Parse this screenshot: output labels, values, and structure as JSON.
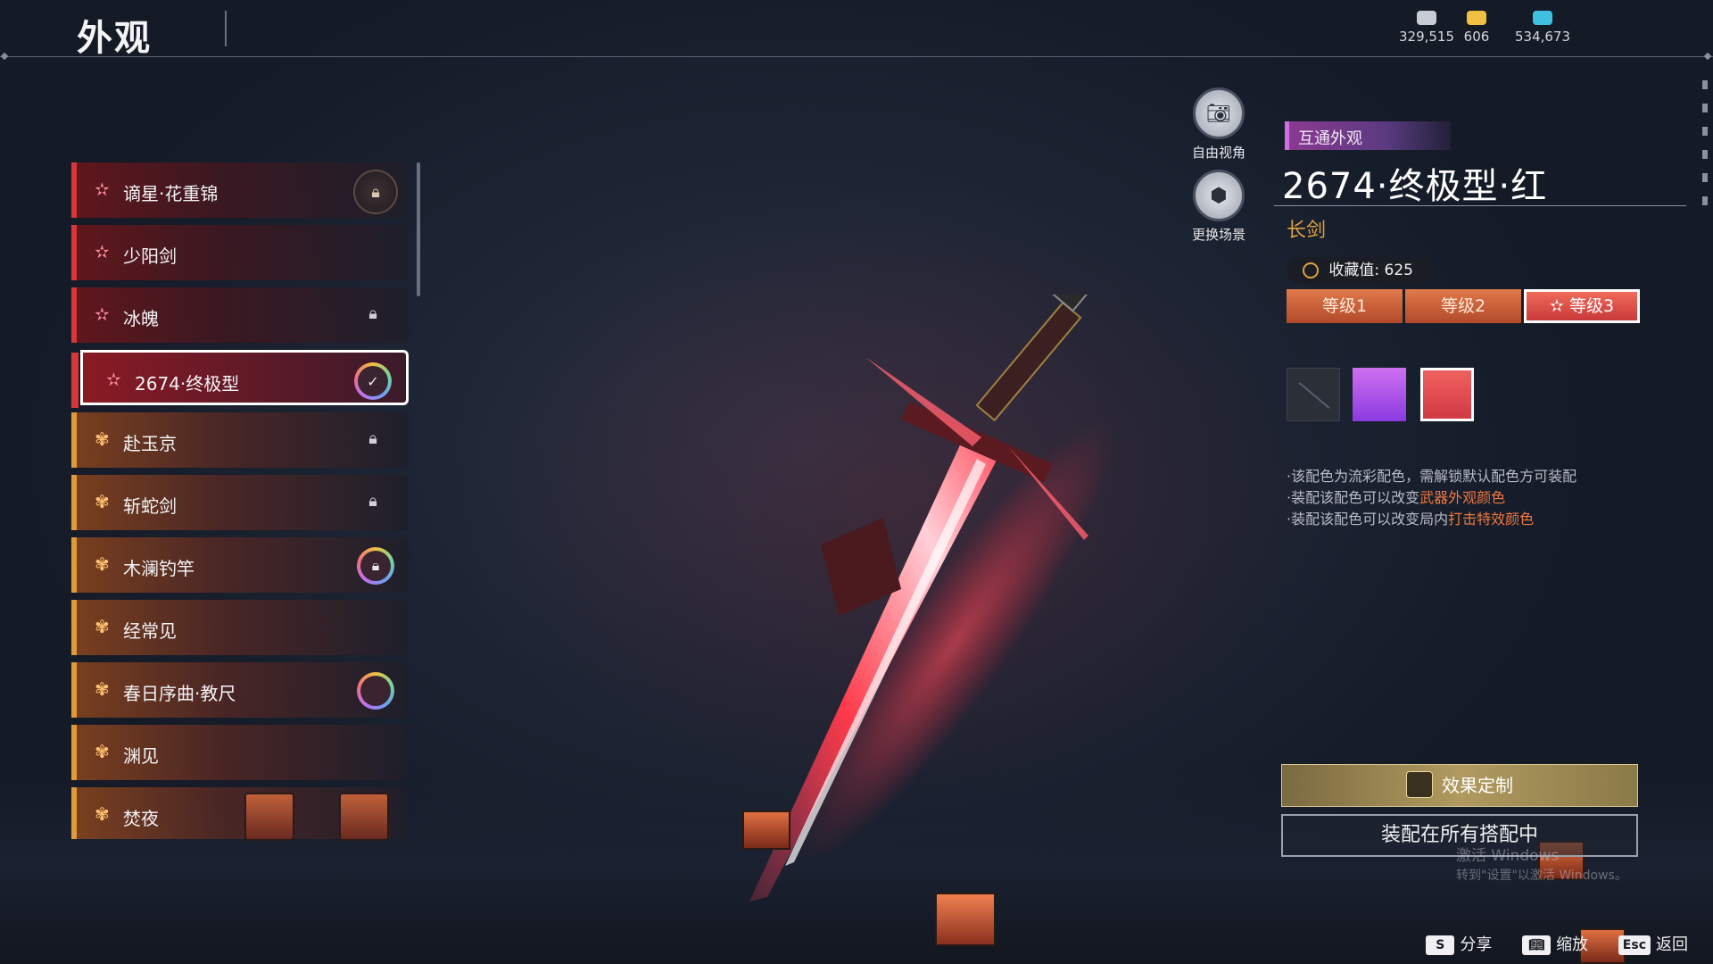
{
  "header": {
    "title": "外观"
  },
  "currencies": [
    {
      "icon": "coin-stack-icon",
      "value": "329,515",
      "color": "#c8ccd4"
    },
    {
      "icon": "gold-ingot-icon",
      "value": "606",
      "color": "#f0c040"
    },
    {
      "icon": "feather-icon",
      "value": "534,673",
      "color": "#40c0e0"
    }
  ],
  "list": {
    "items": [
      {
        "label": "谪星·花重锦",
        "rarity": "red",
        "status": "locked-badge"
      },
      {
        "label": "少阳剑",
        "rarity": "red",
        "status": "none"
      },
      {
        "label": "冰魄",
        "rarity": "red",
        "status": "locked"
      },
      {
        "label": "2674·终极型",
        "rarity": "red",
        "status": "equipped",
        "selected": true
      },
      {
        "label": "赴玉京",
        "rarity": "gold",
        "status": "locked"
      },
      {
        "label": "斩蛇剑",
        "rarity": "gold",
        "status": "locked"
      },
      {
        "label": "木澜钓竿",
        "rarity": "gold",
        "status": "ring-locked"
      },
      {
        "label": "经常见",
        "rarity": "gold",
        "status": "none"
      },
      {
        "label": "春日序曲·教尺",
        "rarity": "gold",
        "status": "ring"
      },
      {
        "label": "渊见",
        "rarity": "gold",
        "status": "none"
      },
      {
        "label": "焚夜",
        "rarity": "gold",
        "status": "lantern"
      }
    ]
  },
  "side_buttons": {
    "free_view": "自由视角",
    "change_scene": "更换场景"
  },
  "detail": {
    "tag": "互通外观",
    "name": "2674·终极型·红",
    "weapon_type": "长剑",
    "collect_label": "收藏值:",
    "collect_value": "625",
    "levels": [
      "等级1",
      "等级2",
      "等级3"
    ],
    "active_level_index": 2,
    "swatches": [
      {
        "name": "none",
        "color": "#2a2f38"
      },
      {
        "name": "purple",
        "color": "#b050e8"
      },
      {
        "name": "red",
        "color": "#e44a50",
        "selected": true
      }
    ],
    "notes": {
      "line1": "·该配色为流彩配色，需解锁默认配色方可装配",
      "line2_prefix": "·装配该配色可以改变",
      "line2_highlight": "武器外观颜色",
      "line3_prefix": "·装配该配色可以改变局内",
      "line3_highlight": "打击特效颜色"
    },
    "highlight_color": "#f07840"
  },
  "actions": {
    "effect_custom": "效果定制",
    "equip_all": "装配在所有搭配中"
  },
  "watermark": {
    "line1": "激活 Windows",
    "line2": "转到\"设置\"以激活 Windows。"
  },
  "hotkeys": [
    {
      "key": "S",
      "label": "分享"
    },
    {
      "key": "缩",
      "label": "缩放",
      "icon": "book-icon"
    },
    {
      "key": "Esc",
      "label": "返回"
    }
  ]
}
